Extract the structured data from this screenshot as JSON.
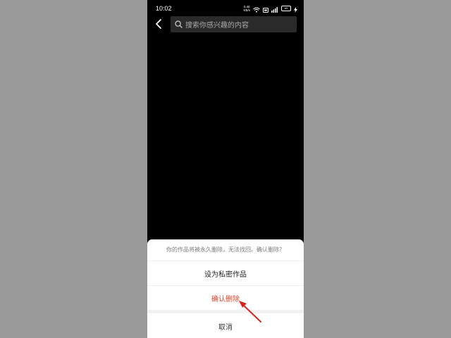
{
  "status_bar": {
    "time": "10:02",
    "net_speed_value": "0.46",
    "net_speed_unit": "KB/s",
    "battery": "69"
  },
  "header": {
    "back_icon": "chevron-left-icon",
    "search_placeholder": "搜索你感兴趣的内容"
  },
  "action_sheet": {
    "message": "你的作品将被永久删除，无法找回。确认删除？",
    "options": {
      "set_private": "设为私密作品",
      "confirm_delete": "确认删除",
      "cancel": "取消"
    },
    "delete_color": "#e0462a"
  },
  "annotation": {
    "arrow_color": "#d9241c"
  }
}
